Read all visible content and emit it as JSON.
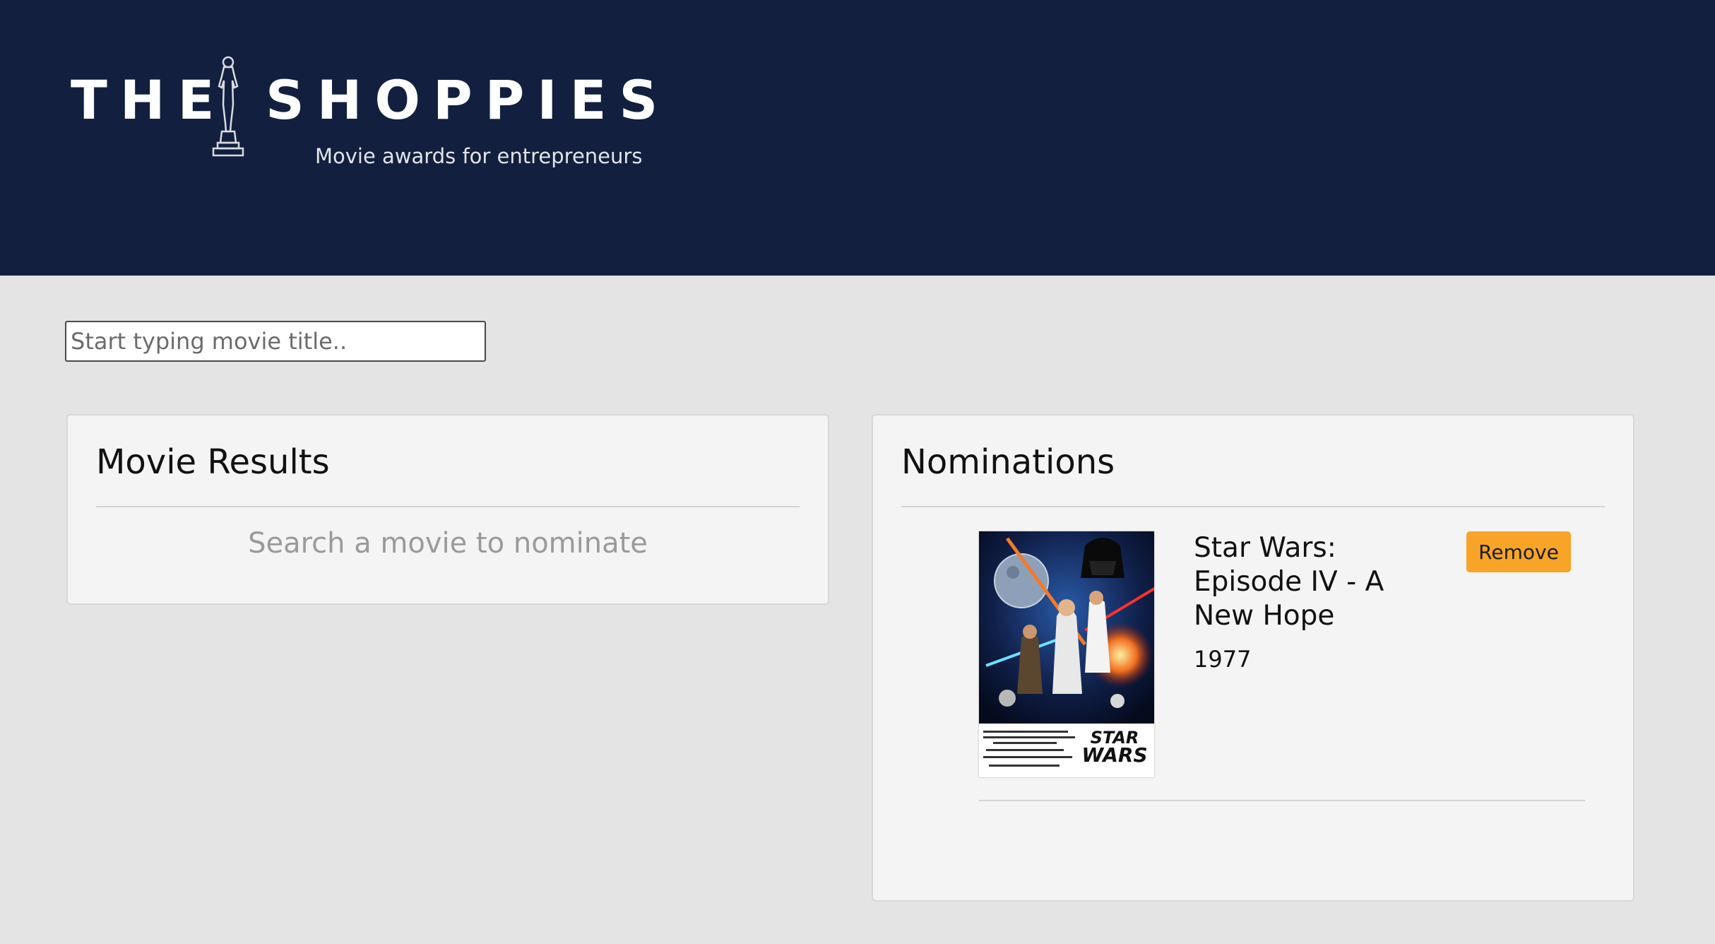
{
  "header": {
    "logo": {
      "word_left": "THE",
      "word_right": "SHOPPIES",
      "tagline": "Movie awards for entrepreneurs",
      "icon": "oscar-statue-icon"
    },
    "background_color": "#131f3e"
  },
  "search": {
    "placeholder": "Start typing movie title..",
    "value": ""
  },
  "results_panel": {
    "title": "Movie Results",
    "empty_message": "Search a movie to nominate"
  },
  "nominations_panel": {
    "title": "Nominations",
    "items": [
      {
        "title": "Star Wars: Episode IV - A New Hope",
        "year": "1977",
        "remove_label": "Remove",
        "poster_icon": "movie-poster-image",
        "poster_logo": "STAR WARS"
      }
    ]
  },
  "colors": {
    "accent_button": "#f7a428",
    "page_background": "#e4e4e4",
    "panel_background": "#f4f4f4"
  }
}
